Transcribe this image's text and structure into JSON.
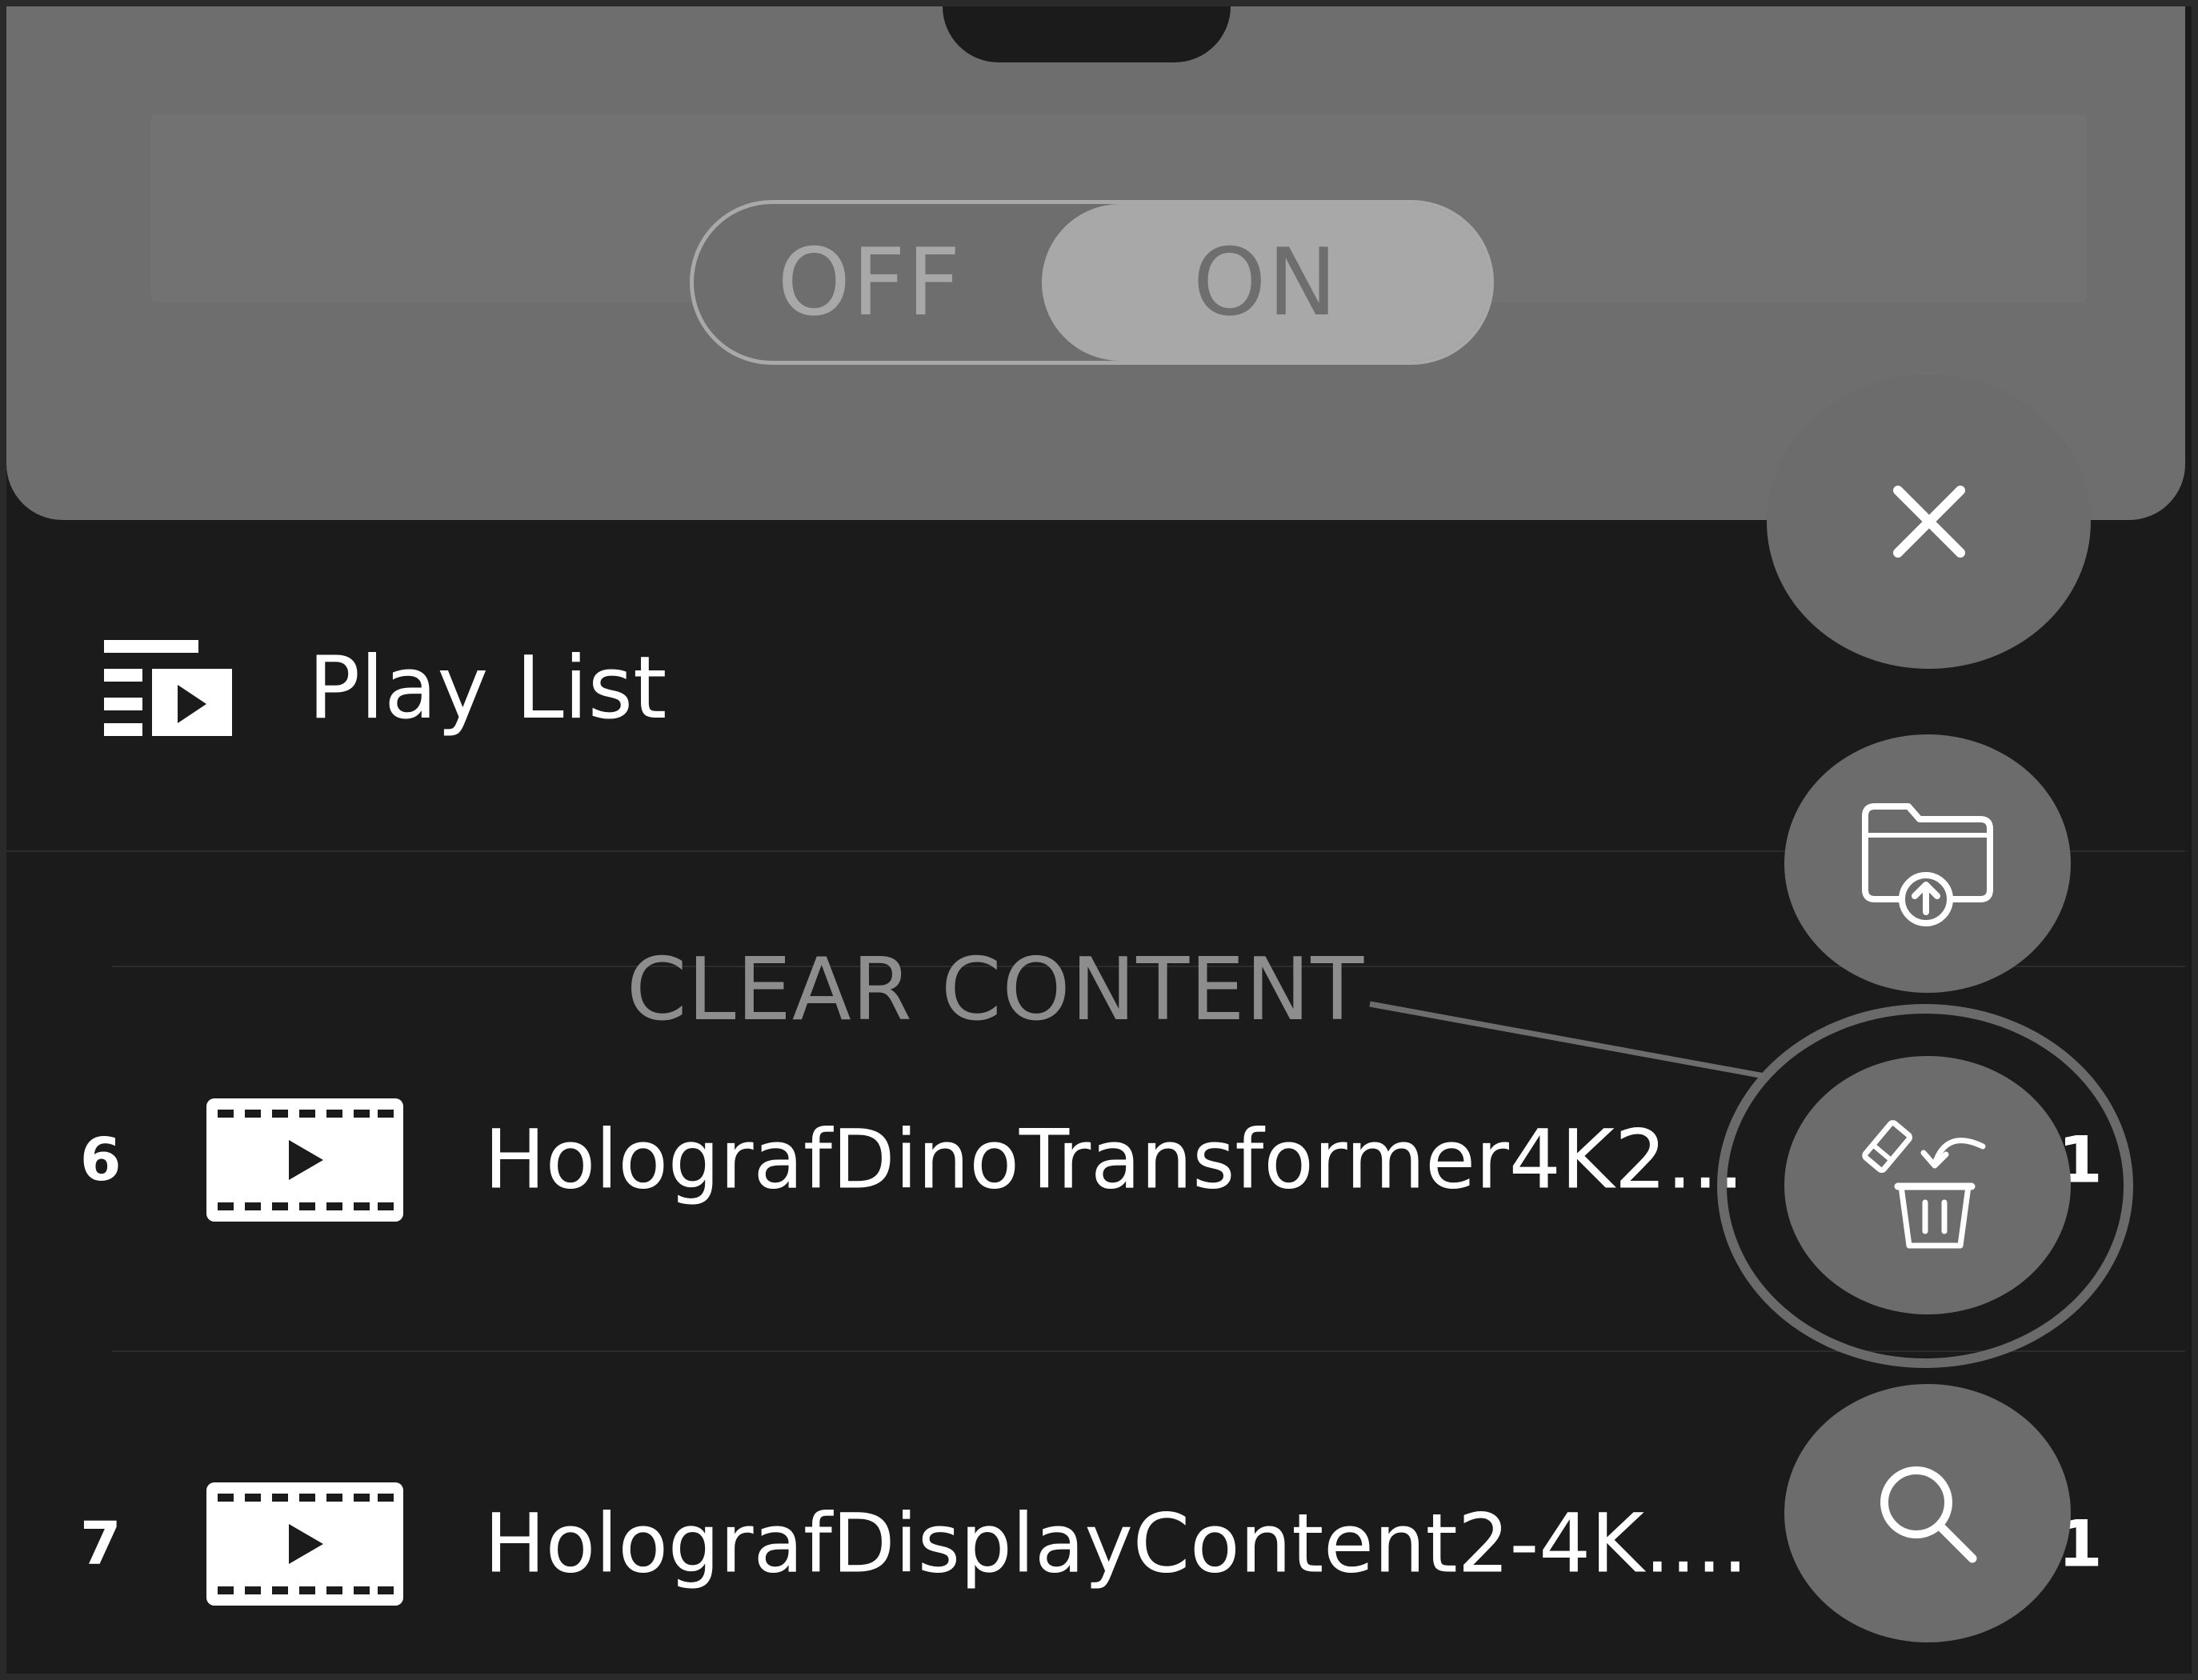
{
  "toggle": {
    "off_label": "OFF",
    "on_label": "ON",
    "state": "ON"
  },
  "playlist": {
    "title": "Play List",
    "items": [
      {
        "number": "6",
        "name": "HolografDinoTransformer4K2...",
        "trailing": "1"
      },
      {
        "number": "7",
        "name": "HolografDisplayContent2-4K....",
        "trailing": "1"
      }
    ]
  },
  "fab_menu": {
    "close_icon": "close-icon",
    "upload_icon": "folder-upload-icon",
    "clear_icon": "clear-content-icon",
    "search_icon": "search-icon",
    "clear_label": "CLEAR CONTENT"
  },
  "colors": {
    "background": "#1b1b1b",
    "panel_dim": "#6e6e6e",
    "fab": "#6c6c6c",
    "text": "#ffffff"
  }
}
